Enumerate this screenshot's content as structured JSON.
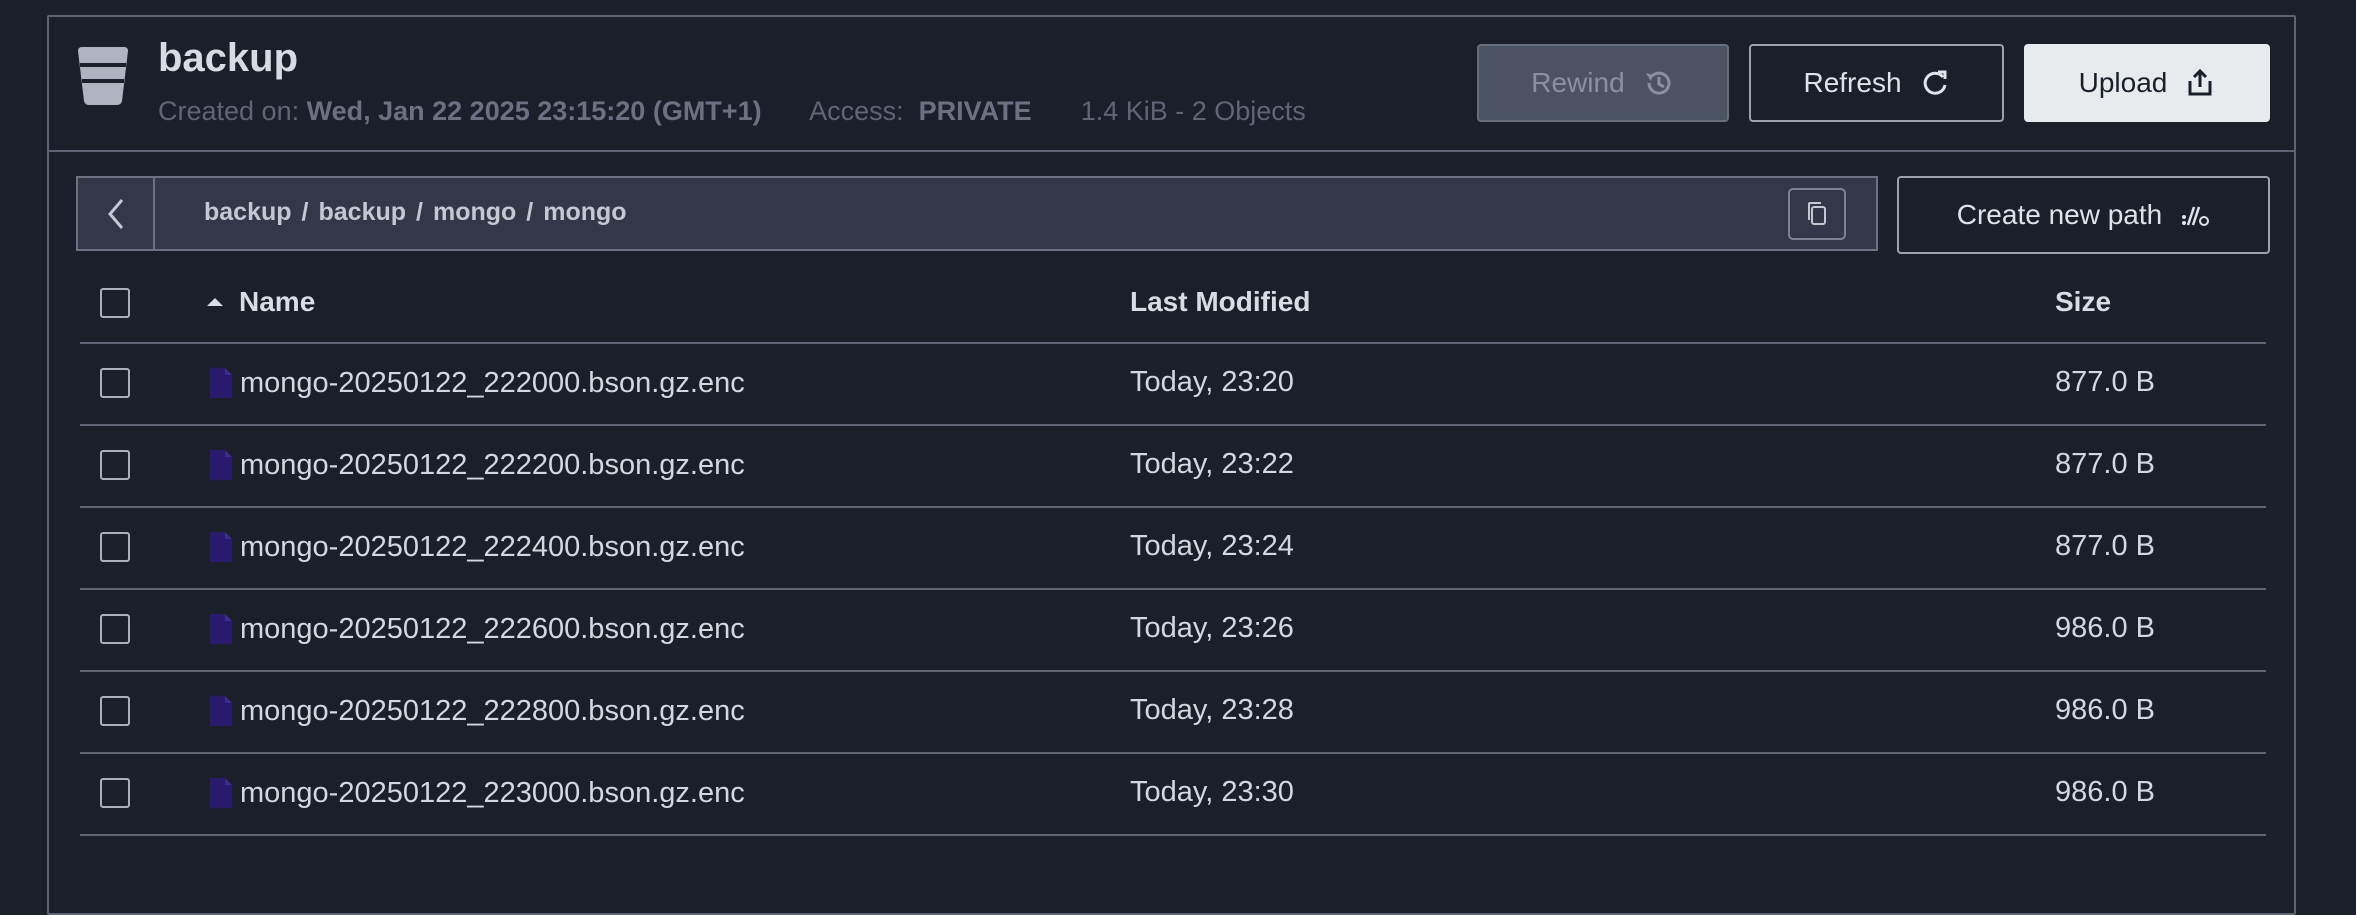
{
  "bucket": {
    "title": "backup",
    "created_label": "Created on:",
    "created_value": "Wed, Jan 22 2025 23:15:20 (GMT+1)",
    "access_label": "Access:",
    "access_value": "PRIVATE",
    "usage": "1.4 KiB - 2 Objects"
  },
  "toolbar": {
    "rewind_label": "Rewind",
    "refresh_label": "Refresh",
    "upload_label": "Upload",
    "create_path_label": "Create new path"
  },
  "breadcrumb": [
    "backup",
    "backup",
    "mongo",
    "mongo"
  ],
  "table": {
    "headers": {
      "name": "Name",
      "modified": "Last Modified",
      "size": "Size"
    },
    "rows": [
      {
        "name": "mongo-20250122_222000.bson.gz.enc",
        "modified": "Today, 23:20",
        "size": "877.0 B"
      },
      {
        "name": "mongo-20250122_222200.bson.gz.enc",
        "modified": "Today, 23:22",
        "size": "877.0 B"
      },
      {
        "name": "mongo-20250122_222400.bson.gz.enc",
        "modified": "Today, 23:24",
        "size": "877.0 B"
      },
      {
        "name": "mongo-20250122_222600.bson.gz.enc",
        "modified": "Today, 23:26",
        "size": "986.0 B"
      },
      {
        "name": "mongo-20250122_222800.bson.gz.enc",
        "modified": "Today, 23:28",
        "size": "986.0 B"
      },
      {
        "name": "mongo-20250122_223000.bson.gz.enc",
        "modified": "Today, 23:30",
        "size": "986.0 B"
      }
    ]
  },
  "icons": {
    "bucket": "bucket-icon",
    "rewind": "history-icon",
    "refresh": "refresh-icon",
    "upload": "upload-icon",
    "back": "chevron-left-icon",
    "copy": "copy-icon",
    "new_path": "new-path-icon",
    "sort": "sort-ascending-icon",
    "file": "file-icon"
  },
  "colors": {
    "background": "#1b1f2a",
    "file_icon": "#2a1a6e",
    "upload_button": "#e8ebee"
  }
}
